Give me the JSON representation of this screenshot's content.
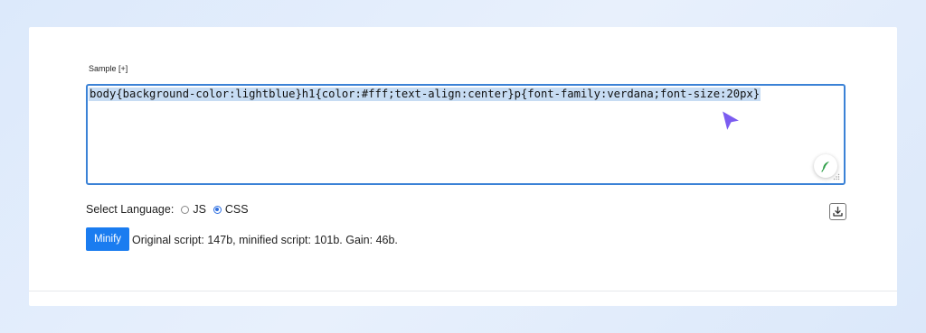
{
  "sample_label": "Sample [+]",
  "editor": {
    "code": "body{background-color:lightblue}h1{color:#fff;text-align:center}p{font-family:verdana;font-size:20px}"
  },
  "language": {
    "label": "Select Language:",
    "options": [
      {
        "label": "JS",
        "selected": false
      },
      {
        "label": "CSS",
        "selected": true
      }
    ]
  },
  "minify_button": "Minify",
  "result": "Original script: 147b, minified script: 101b. Gain: 46b.",
  "icons": {
    "editor_action": "feather-icon",
    "download": "download-icon",
    "cursor": "mouse-cursor-icon"
  },
  "colors": {
    "accent": "#1a7cf0",
    "editor_border": "#3b82d6",
    "selection": "#c7dcf3",
    "cursor": "#7b5cf0"
  }
}
